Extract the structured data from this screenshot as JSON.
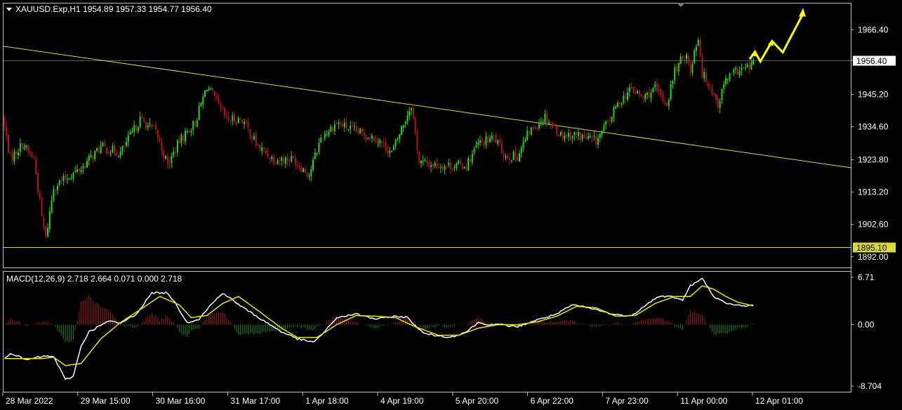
{
  "chart_data": {
    "type": "candlestick",
    "symbol_header": "XAUUSD.Exp,H1  1954.89 1957.33 1954.77 1956.40",
    "ohlc_last": {
      "open": 1954.89,
      "high": 1957.33,
      "low": 1954.77,
      "close": 1956.4
    },
    "price_axis": {
      "ticks": [
        1966.4,
        1956.4,
        1945.2,
        1934.6,
        1923.8,
        1913.2,
        1902.6,
        1892.0
      ],
      "tick_labels": [
        "1966.40",
        "1956.40",
        "1945.20",
        "1934.60",
        "1923.80",
        "1913.20",
        "1902.60",
        "1892.00"
      ],
      "ylim": [
        1888.5,
        1975.0
      ]
    },
    "time_axis": {
      "labels": [
        "28 Mar 2022",
        "29 Mar 15:00",
        "30 Mar 16:00",
        "31 Mar 17:00",
        "1 Apr 18:00",
        "4 Apr 19:00",
        "5 Apr 20:00",
        "6 Apr 22:00",
        "7 Apr 23:00",
        "11 Apr 00:00",
        "12 Apr 01:00"
      ]
    },
    "horizontal_lines": [
      {
        "price": 1956.4,
        "label": "1956.40",
        "color": "#5a5a5a"
      },
      {
        "price": 1895.1,
        "label": "1895.10",
        "color": "#d9d93a"
      }
    ],
    "trendline": {
      "from": [
        0,
        1961.0
      ],
      "to": [
        1,
        1921.2
      ],
      "color": "#d9d93a"
    },
    "projection_arrow": {
      "points": [
        [
          0,
          1956.8
        ],
        [
          0.1,
          1959.2
        ],
        [
          0.2,
          1956.0
        ],
        [
          0.42,
          1962.7
        ],
        [
          0.62,
          1959.0
        ],
        [
          1.0,
          1973.5
        ]
      ],
      "color": "#ffff00"
    },
    "candle_path": [
      [
        0,
        1938
      ],
      [
        4,
        1924
      ],
      [
        10,
        1929
      ],
      [
        16,
        1924
      ],
      [
        20,
        1905
      ],
      [
        22,
        1898
      ],
      [
        26,
        1915
      ],
      [
        40,
        1921
      ],
      [
        50,
        1928
      ],
      [
        60,
        1926
      ],
      [
        70,
        1937
      ],
      [
        78,
        1933
      ],
      [
        84,
        1922
      ],
      [
        90,
        1930
      ],
      [
        98,
        1936
      ],
      [
        104,
        1948
      ],
      [
        114,
        1937
      ],
      [
        122,
        1937
      ],
      [
        130,
        1928
      ],
      [
        138,
        1924
      ],
      [
        148,
        1924
      ],
      [
        156,
        1919
      ],
      [
        162,
        1931
      ],
      [
        170,
        1936
      ],
      [
        180,
        1933
      ],
      [
        190,
        1931
      ],
      [
        198,
        1926
      ],
      [
        208,
        1942
      ],
      [
        212,
        1923
      ],
      [
        220,
        1922
      ],
      [
        230,
        1922
      ],
      [
        236,
        1922
      ],
      [
        242,
        1929
      ],
      [
        250,
        1931
      ],
      [
        256,
        1925
      ],
      [
        262,
        1925
      ],
      [
        268,
        1933
      ],
      [
        276,
        1938
      ],
      [
        284,
        1932
      ],
      [
        292,
        1932
      ],
      [
        296,
        1931
      ],
      [
        302,
        1930
      ],
      [
        308,
        1936
      ],
      [
        314,
        1943
      ],
      [
        320,
        1947
      ],
      [
        326,
        1944
      ],
      [
        332,
        1947
      ],
      [
        338,
        1942
      ],
      [
        342,
        1953
      ],
      [
        348,
        1959
      ],
      [
        350,
        1952
      ],
      [
        352,
        1960
      ],
      [
        354,
        1964
      ],
      [
        356,
        1952
      ],
      [
        360,
        1948
      ],
      [
        364,
        1942
      ],
      [
        368,
        1950
      ],
      [
        374,
        1953
      ],
      [
        380,
        1954
      ],
      [
        382,
        1956.4
      ]
    ],
    "indicator": {
      "name": "MACD(12,26,9)",
      "header": "MACD(12,26,9) 2.718 2.664 0.071 0.000 2.718",
      "ticks": [
        6.71,
        0.0,
        -8.704
      ],
      "tick_labels": [
        "6.71",
        "0.00",
        "-8.704"
      ],
      "ylim": [
        -8.704,
        6.71
      ],
      "macd_path": [
        [
          0,
          -5
        ],
        [
          4,
          -4
        ],
        [
          12,
          -5
        ],
        [
          20,
          -4.5
        ],
        [
          26,
          -4.5
        ],
        [
          32,
          -7.8
        ],
        [
          36,
          -7.3
        ],
        [
          40,
          -3
        ],
        [
          44,
          -1
        ],
        [
          54,
          0.5
        ],
        [
          60,
          0.2
        ],
        [
          68,
          1.5
        ],
        [
          76,
          4.5
        ],
        [
          84,
          4.5
        ],
        [
          88,
          3
        ],
        [
          94,
          0.3
        ],
        [
          100,
          0.8
        ],
        [
          106,
          2.8
        ],
        [
          112,
          4.5
        ],
        [
          122,
          2.5
        ],
        [
          132,
          0.7
        ],
        [
          142,
          -1
        ],
        [
          150,
          -2
        ],
        [
          158,
          -2.5
        ],
        [
          164,
          -1
        ],
        [
          170,
          1
        ],
        [
          180,
          1.5
        ],
        [
          190,
          0.8
        ],
        [
          200,
          1.2
        ],
        [
          206,
          1
        ],
        [
          214,
          -1.2
        ],
        [
          220,
          -1.5
        ],
        [
          228,
          -1.8
        ],
        [
          236,
          -1
        ],
        [
          242,
          0.3
        ],
        [
          248,
          0
        ],
        [
          254,
          0
        ],
        [
          262,
          -0.3
        ],
        [
          270,
          0.5
        ],
        [
          276,
          1
        ],
        [
          282,
          1.5
        ],
        [
          290,
          2.8
        ],
        [
          296,
          2.5
        ],
        [
          304,
          2
        ],
        [
          310,
          1.5
        ],
        [
          320,
          1.2
        ],
        [
          328,
          3
        ],
        [
          334,
          4
        ],
        [
          340,
          4
        ],
        [
          346,
          3.5
        ],
        [
          350,
          5.5
        ],
        [
          356,
          6.5
        ],
        [
          362,
          4
        ],
        [
          368,
          3
        ],
        [
          372,
          2.8
        ],
        [
          378,
          2.7
        ],
        [
          382,
          2.718
        ]
      ],
      "signal_path": [
        [
          0,
          -4.8
        ],
        [
          10,
          -4.8
        ],
        [
          20,
          -4.8
        ],
        [
          26,
          -4.6
        ],
        [
          32,
          -5.8
        ],
        [
          40,
          -5.5
        ],
        [
          50,
          -2
        ],
        [
          60,
          0.3
        ],
        [
          72,
          2.5
        ],
        [
          80,
          4
        ],
        [
          90,
          2.8
        ],
        [
          96,
          1
        ],
        [
          104,
          1.3
        ],
        [
          112,
          3
        ],
        [
          120,
          4
        ],
        [
          130,
          2
        ],
        [
          142,
          -0.5
        ],
        [
          150,
          -1.8
        ],
        [
          160,
          -1.8
        ],
        [
          170,
          0
        ],
        [
          180,
          1.3
        ],
        [
          190,
          1.2
        ],
        [
          200,
          1
        ],
        [
          210,
          -0.3
        ],
        [
          222,
          -1.5
        ],
        [
          232,
          -1.5
        ],
        [
          242,
          -0.5
        ],
        [
          252,
          0
        ],
        [
          262,
          0
        ],
        [
          272,
          0.4
        ],
        [
          282,
          1.2
        ],
        [
          292,
          2.6
        ],
        [
          302,
          2.4
        ],
        [
          312,
          1.2
        ],
        [
          322,
          1.3
        ],
        [
          332,
          3
        ],
        [
          342,
          4
        ],
        [
          350,
          4
        ],
        [
          356,
          5.5
        ],
        [
          362,
          5
        ],
        [
          368,
          4
        ],
        [
          374,
          3.2
        ],
        [
          382,
          2.664
        ]
      ]
    }
  }
}
